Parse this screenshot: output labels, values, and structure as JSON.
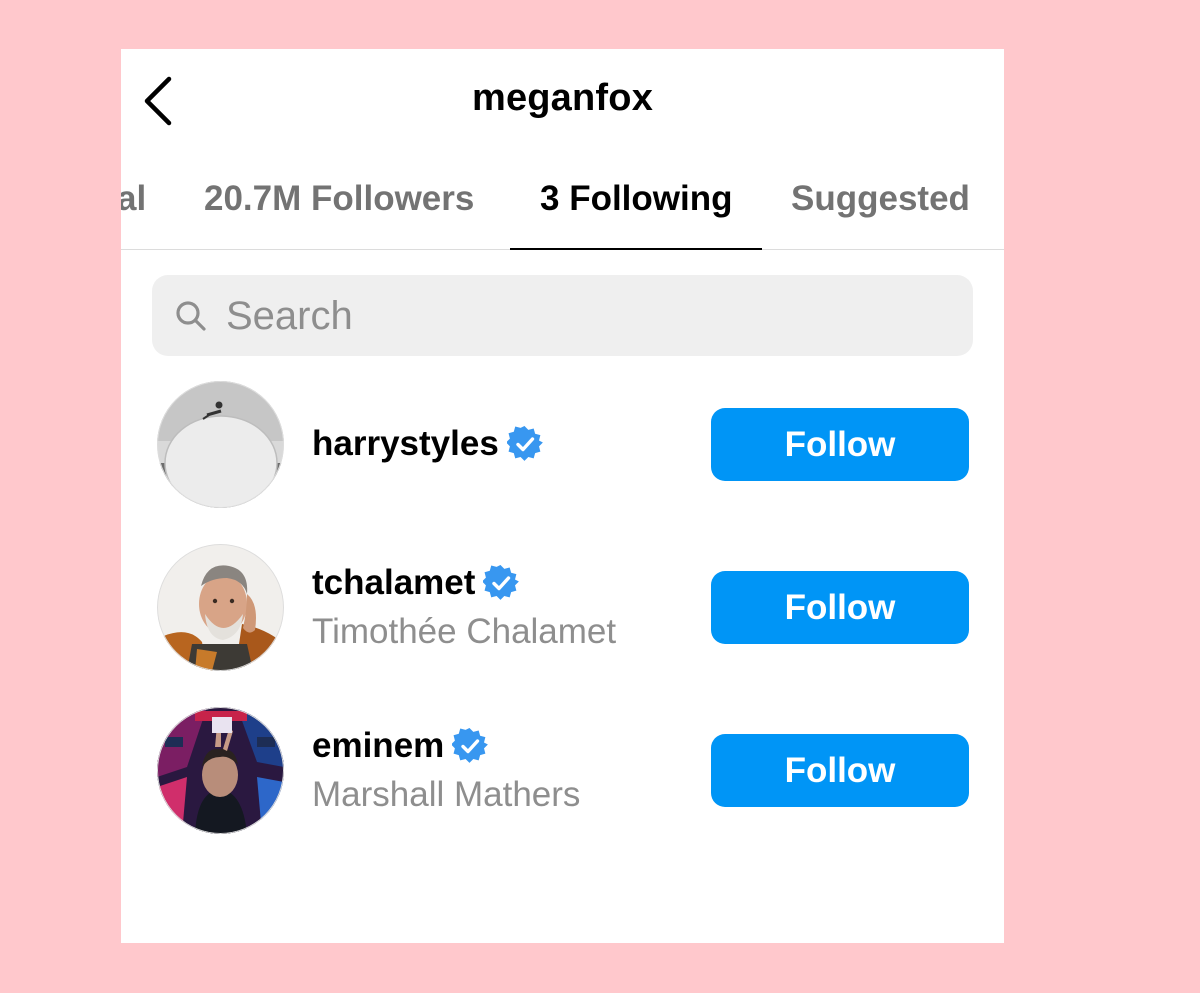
{
  "header": {
    "title": "meganfox"
  },
  "tabs": [
    {
      "label": "al",
      "active": false
    },
    {
      "label": "20.7M Followers",
      "active": false
    },
    {
      "label": "3 Following",
      "active": true
    },
    {
      "label": "Suggested",
      "active": false
    }
  ],
  "search": {
    "placeholder": "Search",
    "value": ""
  },
  "following": [
    {
      "username": "harrystyles",
      "full_name": "",
      "verified": true,
      "button_label": "Follow"
    },
    {
      "username": "tchalamet",
      "full_name": "Timothée Chalamet",
      "verified": true,
      "button_label": "Follow"
    },
    {
      "username": "eminem",
      "full_name": "Marshall Mathers",
      "verified": true,
      "button_label": "Follow"
    }
  ],
  "colors": {
    "background": "#ffc8cc",
    "follow_button": "#0095f6",
    "verified_badge": "#3897f0",
    "secondary_text": "#8e8e8e",
    "inactive_tab": "#737373"
  },
  "icons": {
    "back": "chevron-left-icon",
    "search": "search-icon",
    "verified": "verified-badge-icon"
  }
}
